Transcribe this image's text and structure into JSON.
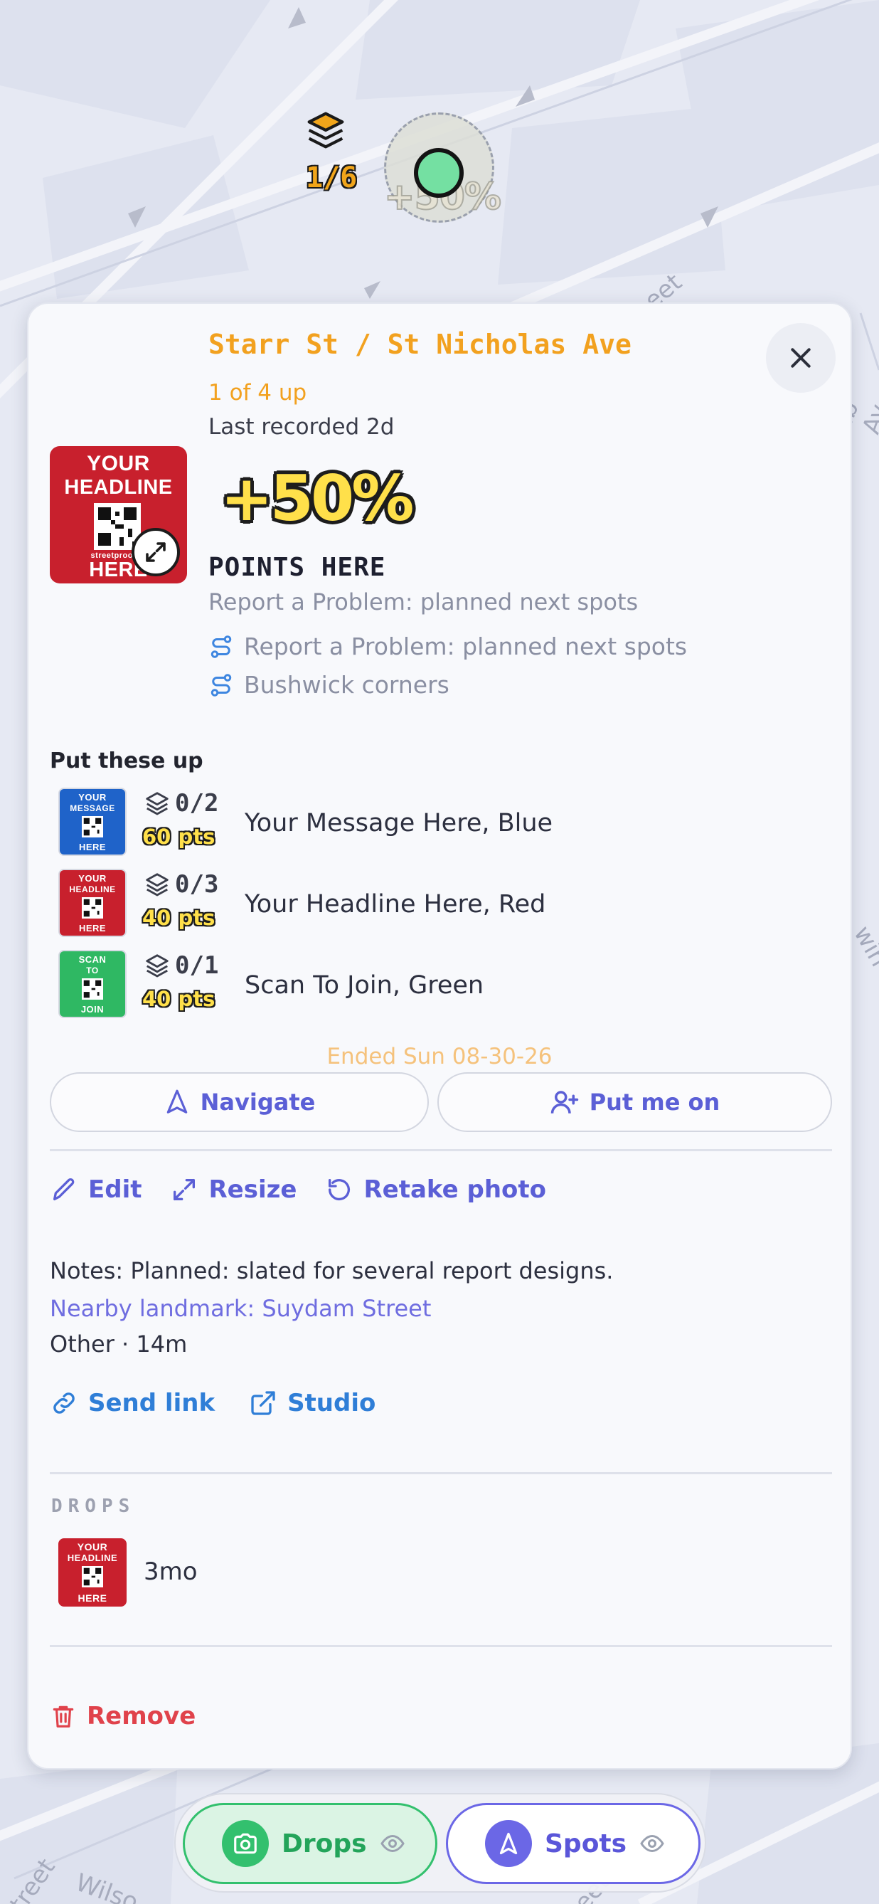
{
  "map": {
    "cluster": {
      "count": "1/6",
      "bonus": "+50%"
    },
    "streets": [
      "eet",
      "Wilso",
      "treet",
      "ib Av",
      "win",
      "eet"
    ]
  },
  "spot": {
    "title": "Starr St / St Nicholas Ave",
    "up_count": "1 of 4 up",
    "last_recorded": "Last recorded 2d",
    "bonus": "+50%",
    "points_label": "POINTS HERE",
    "subtitle": "Report a Problem: planned next spots",
    "routes": [
      {
        "label": "Report a Problem: planned next spots",
        "icon": "route-icon"
      },
      {
        "label": "Bushwick corners",
        "icon": "route-icon"
      }
    ],
    "main_sign": {
      "line1": "YOUR",
      "line2": "HEADLINE",
      "line3": "HERE",
      "small": "streetproof.io"
    }
  },
  "put_up": {
    "label": "Put these up",
    "designs": [
      {
        "count": "0/2",
        "pts": "60 pts",
        "name": "Your Message Here, Blue",
        "color": "#1f63c9",
        "sign": [
          "YOUR",
          "MESSAGE",
          "HERE"
        ]
      },
      {
        "count": "0/3",
        "pts": "40 pts",
        "name": "Your Headline Here, Red",
        "color": "#c8202d",
        "sign": [
          "YOUR",
          "HEADLINE",
          "HERE"
        ]
      },
      {
        "count": "0/1",
        "pts": "40 pts",
        "name": "Scan To Join, Green",
        "color": "#2fb863",
        "sign": [
          "SCAN",
          "TO",
          "JOIN"
        ]
      }
    ]
  },
  "ended": "Ended Sun 08-30-26",
  "buttons": {
    "navigate": "Navigate",
    "put_me_on": "Put me on"
  },
  "actions": {
    "edit": "Edit",
    "resize": "Resize",
    "retake": "Retake photo"
  },
  "notes": "Notes: Planned: slated for several report designs.",
  "landmark": "Nearby landmark: Suydam Street",
  "meta": "Other · 14m",
  "links": {
    "send": "Send link",
    "studio": "Studio"
  },
  "drops": {
    "label": "DROPS",
    "items": [
      {
        "age": "3mo",
        "sign": [
          "YOUR",
          "HEADLINE",
          "HERE"
        ]
      }
    ]
  },
  "remove": "Remove",
  "bottom_bar": {
    "drops": "Drops",
    "spots": "Spots"
  },
  "colors": {
    "accent": "#5b5fd6",
    "orange": "#f2a11f",
    "green": "#33c06e",
    "red": "#e0424b",
    "link": "#2f7ed7"
  }
}
